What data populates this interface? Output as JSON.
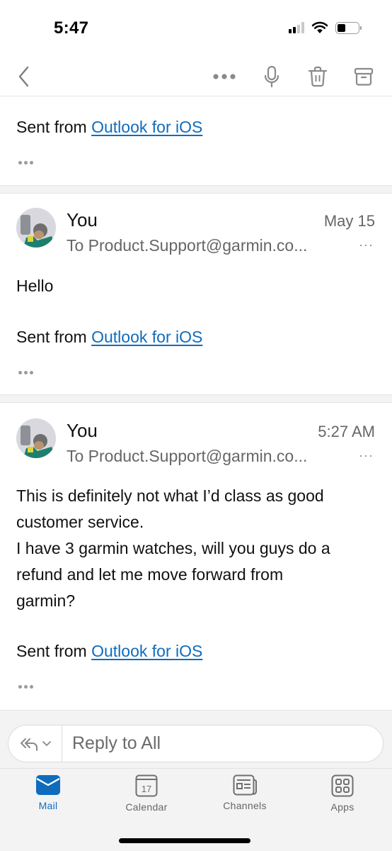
{
  "status_bar": {
    "time": "5:47",
    "signal_bars_active": 2,
    "signal_bars_total": 4,
    "battery_level_fraction": 0.3
  },
  "toolbar": {
    "back_icon": "chevron-left-icon",
    "more_icon": "ellipsis-icon",
    "mic_icon": "microphone-icon",
    "trash_icon": "trash-icon",
    "archive_icon": "archive-icon"
  },
  "messages": [
    {
      "partial": true,
      "signature_prefix": "Sent from ",
      "signature_link": "Outlook for iOS"
    },
    {
      "sender": "You",
      "date": "May 15",
      "recipient": "To Product.Support@garmin.co...",
      "recipient_more": "···",
      "body": [
        "Hello"
      ],
      "signature_prefix": "Sent from ",
      "signature_link": "Outlook for iOS"
    },
    {
      "sender": "You",
      "date": "5:27 AM",
      "recipient": "To Product.Support@garmin.co...",
      "recipient_more": "···",
      "body": [
        "This is definitely not what I’d class as good",
        "customer service.",
        "I have 3 garmin watches, will you guys do a",
        "refund and let me move forward from",
        "garmin?"
      ],
      "signature_prefix": "Sent from ",
      "signature_link": "Outlook for iOS"
    }
  ],
  "reply": {
    "placeholder": "Reply to All",
    "action_icon": "reply-all-icon"
  },
  "tabs": [
    {
      "label": "Mail",
      "icon": "mail-icon",
      "active": true
    },
    {
      "label": "Calendar",
      "icon": "calendar-icon",
      "active": false,
      "day": "17"
    },
    {
      "label": "Channels",
      "icon": "channels-icon",
      "active": false
    },
    {
      "label": "Apps",
      "icon": "apps-icon",
      "active": false
    }
  ],
  "colors": {
    "accent": "#0f6cbd",
    "secondary_text": "#666666",
    "icon_gray": "#8a8a8a",
    "separator_bg": "#f3f3f3"
  }
}
